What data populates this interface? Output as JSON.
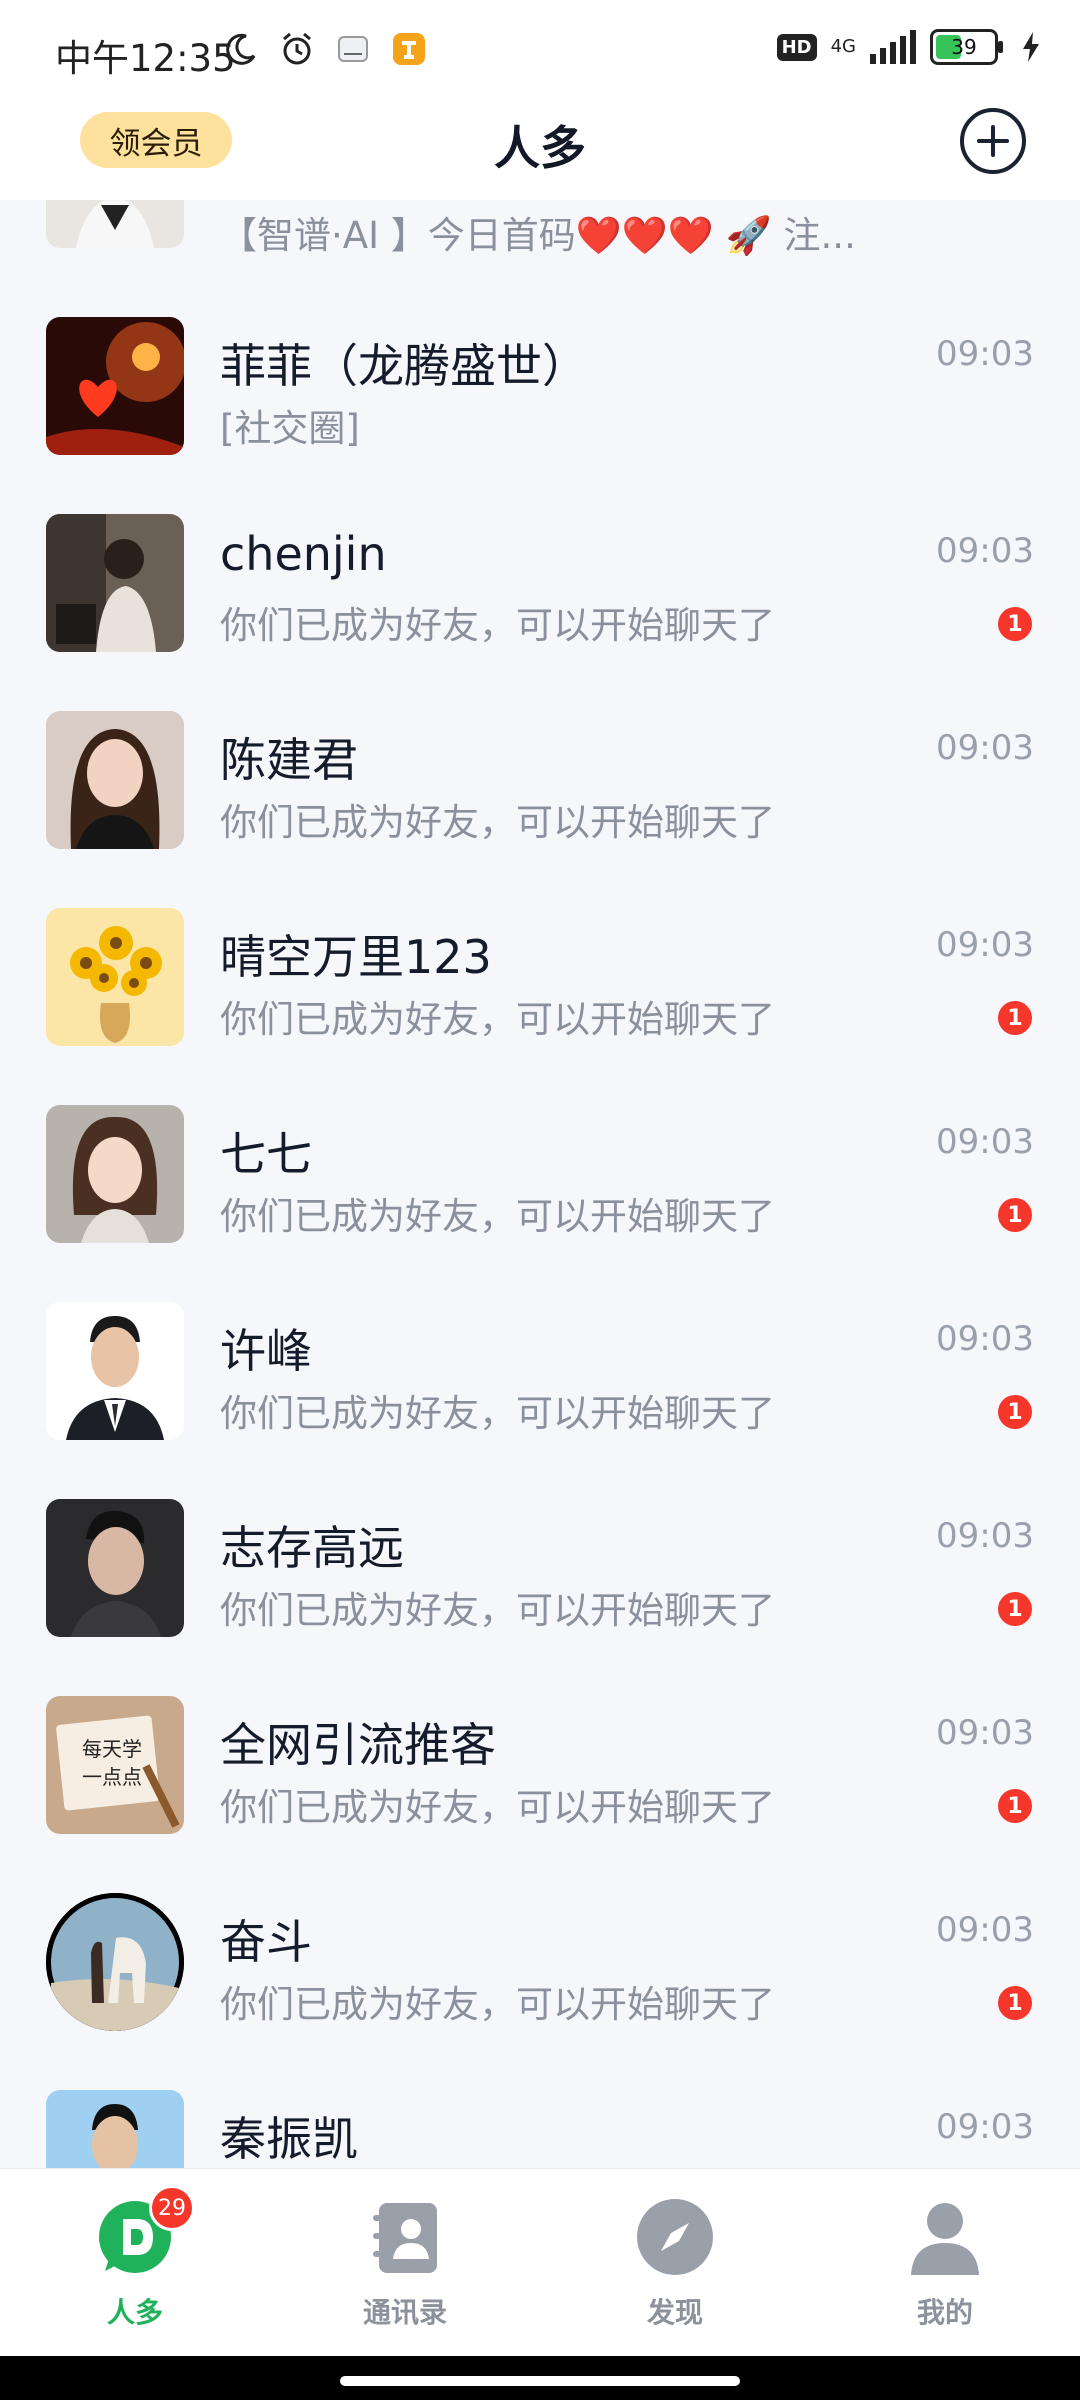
{
  "status_bar": {
    "time": "中午12:35",
    "network": "4G",
    "battery": "39"
  },
  "header": {
    "vip_label": "领会员",
    "title": "人多"
  },
  "partial_chat": {
    "preview": "【智谱·AI 】今日首码❤️❤️❤️ 🚀 注..."
  },
  "chats": [
    {
      "name": "菲菲（龙腾盛世）",
      "preview": "[社交圈]",
      "time": "09:03",
      "unread": ""
    },
    {
      "name": "chenjin",
      "preview": "你们已成为好友，可以开始聊天了",
      "time": "09:03",
      "unread": "1"
    },
    {
      "name": "陈建君",
      "preview": "你们已成为好友，可以开始聊天了",
      "time": "09:03",
      "unread": ""
    },
    {
      "name": "晴空万里123",
      "preview": "你们已成为好友，可以开始聊天了",
      "time": "09:03",
      "unread": "1"
    },
    {
      "name": "七七",
      "preview": "你们已成为好友，可以开始聊天了",
      "time": "09:03",
      "unread": "1"
    },
    {
      "name": "许峰",
      "preview": "你们已成为好友，可以开始聊天了",
      "time": "09:03",
      "unread": "1"
    },
    {
      "name": "志存高远",
      "preview": "你们已成为好友，可以开始聊天了",
      "time": "09:03",
      "unread": "1"
    },
    {
      "name": "全网引流推客",
      "preview": "你们已成为好友，可以开始聊天了",
      "time": "09:03",
      "unread": "1"
    },
    {
      "name": "奋斗",
      "preview": "你们已成为好友，可以开始聊天了",
      "time": "09:03",
      "unread": "1"
    },
    {
      "name": "秦振凯",
      "preview": "",
      "time": "09:03",
      "unread": ""
    }
  ],
  "avatar_texts": {
    "note_line1": "每天学",
    "note_line2": "一点点"
  },
  "bottom_nav": {
    "items": [
      {
        "label": "人多",
        "badge": "29"
      },
      {
        "label": "通讯录"
      },
      {
        "label": "发现"
      },
      {
        "label": "我的"
      }
    ]
  },
  "colors": {
    "accent_green": "#20b25a",
    "badge_red": "#f5362a",
    "vip_gold": "#fde19c"
  }
}
